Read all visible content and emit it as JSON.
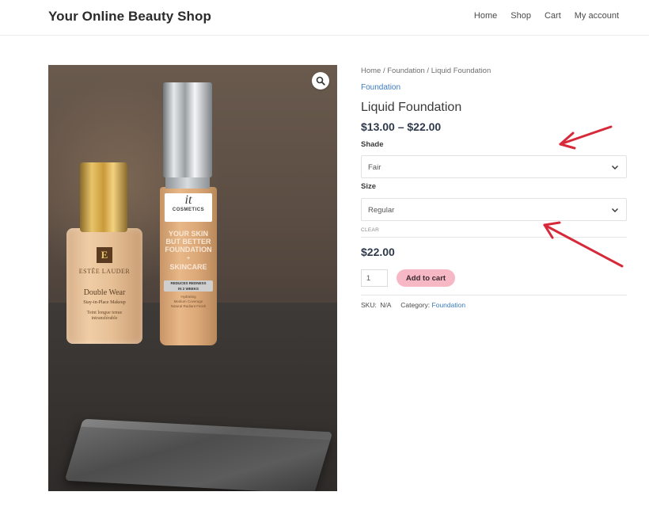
{
  "header": {
    "site_title": "Your Online Beauty Shop",
    "nav": [
      "Home",
      "Shop",
      "Cart",
      "My account"
    ]
  },
  "product_image": {
    "bottle1": {
      "logo": "E",
      "brand": "ESTĒE LAUDER",
      "name_line1": "Double Wear",
      "name_line2": "Stay-in-Place Makeup",
      "sub_line1": "Teint longue tenue",
      "sub_line2": "intransférable"
    },
    "bottle2": {
      "logo_it": "it",
      "logo_cosmetics": "COSMETICS",
      "tag_line1": "YOUR SKIN",
      "tag_line2": "BUT BETTER",
      "tag_line3": "FOUNDATION",
      "tag_line4": "+",
      "tag_line5": "SKINCARE",
      "badge_line1": "REDUCES REDNESS",
      "badge_line2": "IN 2 WEEKS",
      "fine_line1": "Hydrating",
      "fine_line2": "Medium Coverage",
      "fine_line3": "Natural Radiant Finish"
    }
  },
  "summary": {
    "breadcrumb": "Home / Foundation / Liquid Foundation",
    "category": "Foundation",
    "title": "Liquid Foundation",
    "price_range": "$13.00 – $22.00",
    "shade_label": "Shade",
    "shade_value": "Fair",
    "size_label": "Size",
    "size_value": "Regular",
    "clear_label": "CLEAR",
    "current_price": "$22.00",
    "quantity": "1",
    "add_to_cart_label": "Add to cart",
    "sku_label": "SKU:",
    "sku_value": "N/A",
    "category_label": "Category:",
    "category_value": "Foundation"
  },
  "colors": {
    "accent_link": "#3a7bbf",
    "button_pink": "#f7b8c6",
    "annotation_arrow": "#d62a3a"
  }
}
